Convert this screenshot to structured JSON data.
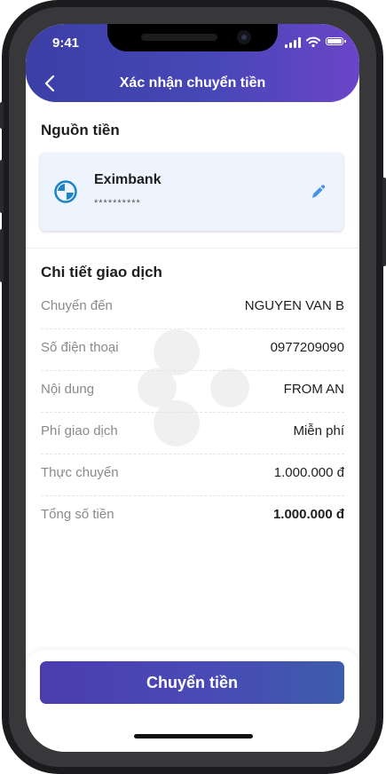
{
  "status_bar": {
    "time": "9:41"
  },
  "header": {
    "title": "Xác nhận chuyển tiền"
  },
  "source": {
    "section_title": "Nguồn tiền",
    "bank_name": "Eximbank",
    "account_masked": "**********"
  },
  "details": {
    "section_title": "Chi tiết giao dịch",
    "rows": [
      {
        "label": "Chuyển đến",
        "value": "NGUYEN VAN B"
      },
      {
        "label": "Số điện thoại",
        "value": "0977209090"
      },
      {
        "label": "Nội dung",
        "value": "FROM AN"
      },
      {
        "label": "Phí giao dịch",
        "value": "Miễn phí"
      },
      {
        "label": "Thực chuyển",
        "value": "1.000.000 đ"
      },
      {
        "label": "Tổng số tiền",
        "value": "1.000.000 đ"
      }
    ]
  },
  "action": {
    "submit_label": "Chuyển tiền"
  },
  "colors": {
    "header_gradient_start": "#3b3fa6",
    "header_gradient_end": "#6a45c8",
    "button_gradient_start": "#4a3db0",
    "button_gradient_end": "#3d5cab",
    "card_background": "#eef4fd",
    "bank_logo_blue": "#1a84c6",
    "edit_icon_blue": "#4a90e2"
  }
}
